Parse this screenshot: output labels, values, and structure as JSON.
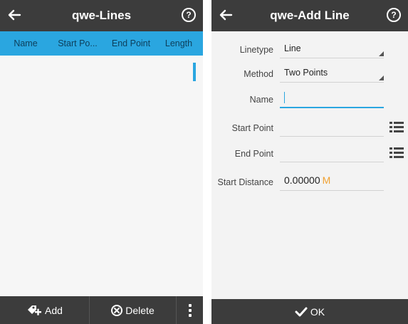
{
  "left": {
    "title": "qwe-Lines",
    "help_symbol": "?",
    "columns": [
      "Name",
      "Start Po...",
      "End Point",
      "Length"
    ],
    "bottom": {
      "add_label": "Add",
      "delete_label": "Delete"
    }
  },
  "right": {
    "title": "qwe-Add Line",
    "help_symbol": "?",
    "fields": {
      "linetype": {
        "label": "Linetype",
        "value": "Line"
      },
      "method": {
        "label": "Method",
        "value": "Two Points"
      },
      "name": {
        "label": "Name",
        "value": ""
      },
      "start_point": {
        "label": "Start Point",
        "value": ""
      },
      "end_point": {
        "label": "End Point",
        "value": ""
      },
      "start_distance": {
        "label": "Start Distance",
        "value": "0.00000",
        "unit": "M"
      }
    },
    "ok_label": "OK"
  },
  "colors": {
    "bar": "#3c3c3c",
    "accent": "#2aa6e0",
    "unit": "#f0a030"
  }
}
